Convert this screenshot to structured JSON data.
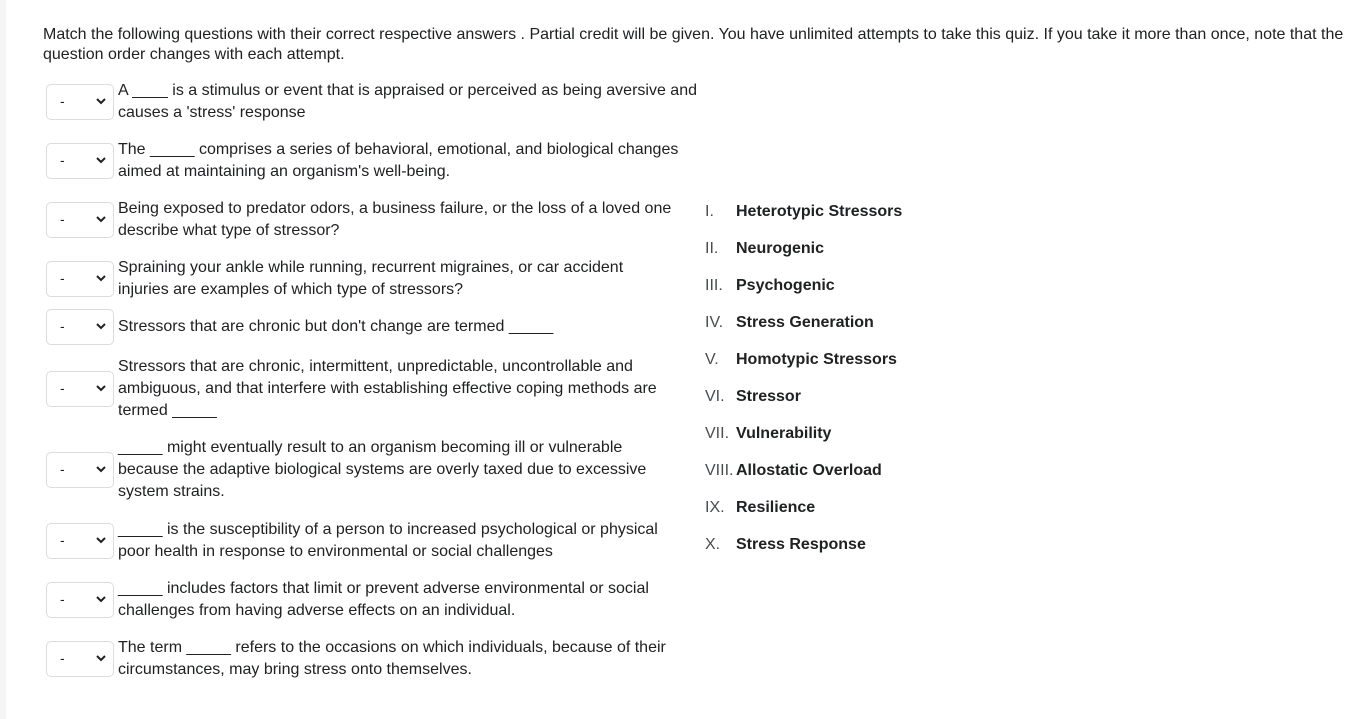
{
  "instructions": "Match the following questions with their correct respective answers . Partial credit will be given. You have unlimited attempts to take this quiz. If you take it more than once, note that the question order changes with each attempt.",
  "questions": [
    {
      "selected": "-",
      "text": "A ____ is a stimulus or event that is appraised or perceived as being aversive and causes a 'stress' response"
    },
    {
      "selected": "-",
      "text": "The _____ comprises a series of behavioral, emotional, and biological changes aimed at maintaining an organism's well-being."
    },
    {
      "selected": "-",
      "text": "Being exposed to predator odors, a business failure, or the loss of a loved one describe what type of stressor?"
    },
    {
      "selected": "-",
      "text": "Spraining your ankle while running, recurrent migraines, or car accident injuries are examples of which type of stressors?"
    },
    {
      "selected": "-",
      "text": "Stressors that are chronic but don't change are termed _____"
    },
    {
      "selected": "-",
      "text": "Stressors that are chronic, intermittent, unpredictable, uncontrollable and ambiguous, and that interfere with establishing effective coping methods are termed _____"
    },
    {
      "selected": "-",
      "text": "_____ might eventually result to an organism becoming ill or vulnerable because the adaptive biological systems are overly taxed due to excessive system strains."
    },
    {
      "selected": "-",
      "text": "_____ is the susceptibility of a person to increased psychological or physical poor health in response to environmental or social challenges"
    },
    {
      "selected": "-",
      "text": "_____ includes factors that limit or prevent adverse environmental or social challenges from having adverse effects on an individual."
    },
    {
      "selected": "-",
      "text": "The term _____ refers to the occasions on which individuals, because of their circumstances, may bring stress onto themselves."
    }
  ],
  "answers": [
    {
      "num": "I.",
      "label": "Heterotypic Stressors"
    },
    {
      "num": "II.",
      "label": "Neurogenic"
    },
    {
      "num": "III.",
      "label": "Psychogenic"
    },
    {
      "num": "IV.",
      "label": "Stress Generation"
    },
    {
      "num": "V.",
      "label": "Homotypic Stressors"
    },
    {
      "num": "VI.",
      "label": "Stressor"
    },
    {
      "num": "VII.",
      "label": "Vulnerability"
    },
    {
      "num": "VIII.",
      "label": "Allostatic Overload"
    },
    {
      "num": "IX.",
      "label": "Resilience"
    },
    {
      "num": "X.",
      "label": "Stress Response"
    }
  ]
}
